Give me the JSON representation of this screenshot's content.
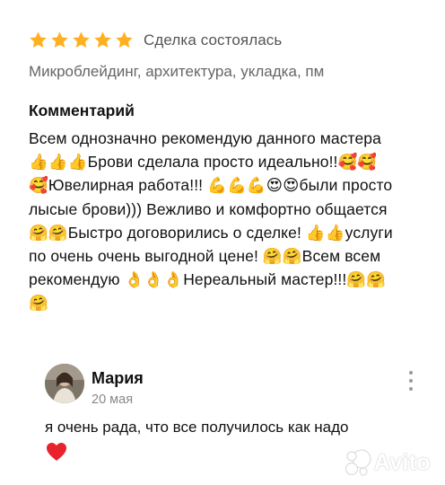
{
  "review": {
    "rating": 5,
    "rating_max": 5,
    "star_color": "#FFB021",
    "deal_status": "Сделка состоялась",
    "services": "Микроблейдинг, архитектура, укладка, пм",
    "comment_title": "Комментарий",
    "comment_text": "Всем однозначно рекомендую данного мастера👍👍👍Брови сделала просто идеально!!🥰🥰🥰Ювелирная работа!!! 💪💪💪😍😍были просто лысые брови))) Вежливо и комфортно общается🤗🤗Быстро договорились о сделке! 👍👍услуги по очень очень выгодной цене! 🤗🤗Всем всем рекомендую 👌👌👌Нереальный мастер!!!🤗🤗🤗"
  },
  "reply": {
    "author": "Мария",
    "date": "20 мая",
    "text": "я очень рада, что все получилось как надо",
    "emoji": "heart-icon",
    "heart_color": "#E8232D"
  },
  "watermark": {
    "brand": "Avito"
  }
}
